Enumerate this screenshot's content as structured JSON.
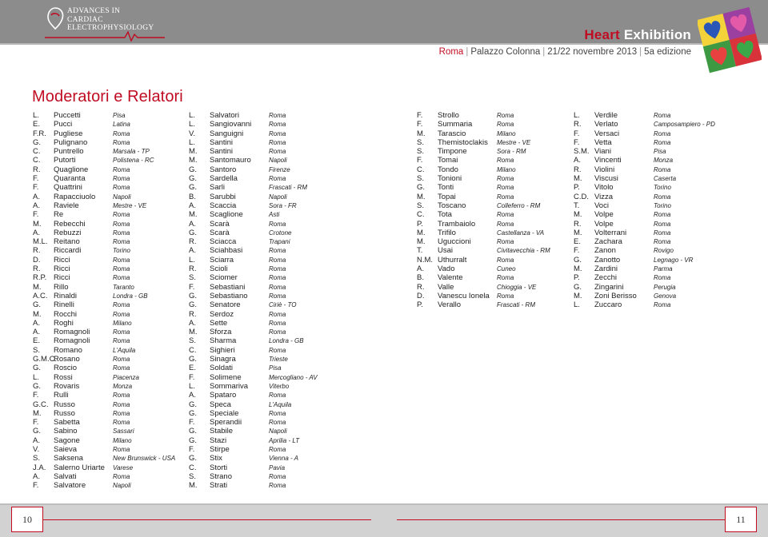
{
  "header": {
    "logo_lines": [
      "Advances in",
      "Cardiac",
      "Electrophysiology"
    ],
    "brand": {
      "prefix": "Heart",
      "suffix": "Exhibition"
    },
    "event": {
      "city": "Roma",
      "venue": "Palazzo Colonna",
      "dates": "21/22 novembre 2013",
      "edition": "5a edizione"
    }
  },
  "page_title": "Moderatori e Relatori",
  "columns": [
    [
      {
        "i": "L.",
        "s": "Puccetti",
        "c": "Pisa"
      },
      {
        "i": "E.",
        "s": "Pucci",
        "c": "Latina"
      },
      {
        "i": "F.R.",
        "s": "Pugliese",
        "c": "Roma"
      },
      {
        "i": "G.",
        "s": "Pulignano",
        "c": "Roma"
      },
      {
        "i": "C.",
        "s": "Puntrello",
        "c": "Marsala - TP"
      },
      {
        "i": "C.",
        "s": "Putorti",
        "c": "Polistena - RC"
      },
      {
        "i": "R.",
        "s": "Quaglione",
        "c": "Roma"
      },
      {
        "i": "F.",
        "s": "Quaranta",
        "c": "Roma"
      },
      {
        "i": "F.",
        "s": "Quattrini",
        "c": "Roma"
      },
      {
        "i": "A.",
        "s": "Rapacciuolo",
        "c": "Napoli"
      },
      {
        "i": "A.",
        "s": "Raviele",
        "c": "Mestre - VE"
      },
      {
        "i": "F.",
        "s": "Re",
        "c": "Roma"
      },
      {
        "i": "M.",
        "s": "Rebecchi",
        "c": "Roma"
      },
      {
        "i": "A.",
        "s": "Rebuzzi",
        "c": "Roma"
      },
      {
        "i": "M.L.",
        "s": "Reitano",
        "c": "Roma"
      },
      {
        "i": "R.",
        "s": "Riccardi",
        "c": "Torino"
      },
      {
        "i": "D.",
        "s": "Ricci",
        "c": "Roma"
      },
      {
        "i": "R.",
        "s": "Ricci",
        "c": "Roma"
      },
      {
        "i": "R.P.",
        "s": "Ricci",
        "c": "Roma"
      },
      {
        "i": "M.",
        "s": "Rillo",
        "c": "Taranto"
      },
      {
        "i": "A.C.",
        "s": "Rinaldi",
        "c": "Londra - GB"
      },
      {
        "i": "G.",
        "s": "Rinelli",
        "c": "Roma"
      },
      {
        "i": "M.",
        "s": "Rocchi",
        "c": "Roma"
      },
      {
        "i": "A.",
        "s": "Roghi",
        "c": "Milano"
      },
      {
        "i": "A.",
        "s": "Romagnoli",
        "c": "Roma"
      },
      {
        "i": "E.",
        "s": "Romagnoli",
        "c": "Roma"
      },
      {
        "i": "S.",
        "s": "Romano",
        "c": "L'Aquila"
      },
      {
        "i": "G.M.C.",
        "s": "Rosano",
        "c": "Roma"
      },
      {
        "i": "G.",
        "s": "Roscio",
        "c": "Roma"
      },
      {
        "i": "L.",
        "s": "Rossi",
        "c": "Piacenza"
      },
      {
        "i": "G.",
        "s": "Rovaris",
        "c": "Monza"
      },
      {
        "i": "F.",
        "s": "Rulli",
        "c": "Roma"
      },
      {
        "i": "G.C.",
        "s": "Russo",
        "c": "Roma"
      },
      {
        "i": "M.",
        "s": "Russo",
        "c": "Roma"
      },
      {
        "i": "F.",
        "s": "Sabetta",
        "c": "Roma"
      },
      {
        "i": "G.",
        "s": "Sabino",
        "c": "Sassari"
      },
      {
        "i": "A.",
        "s": "Sagone",
        "c": "Milano"
      },
      {
        "i": "V.",
        "s": "Saieva",
        "c": "Roma"
      },
      {
        "i": "S.",
        "s": "Saksena",
        "c": "New Brunswick - USA"
      },
      {
        "i": "J.A.",
        "s": "Salerno Uriarte",
        "c": "Varese"
      },
      {
        "i": "A.",
        "s": "Salvati",
        "c": "Roma"
      },
      {
        "i": "F.",
        "s": "Salvatore",
        "c": "Napoli"
      }
    ],
    [
      {
        "i": "L.",
        "s": "Salvatori",
        "c": "Roma"
      },
      {
        "i": "L.",
        "s": "Sangiovanni",
        "c": "Roma"
      },
      {
        "i": "V.",
        "s": "Sanguigni",
        "c": "Roma"
      },
      {
        "i": "L.",
        "s": "Santini",
        "c": "Roma"
      },
      {
        "i": "M.",
        "s": "Santini",
        "c": "Roma"
      },
      {
        "i": "M.",
        "s": "Santomauro",
        "c": "Napoli"
      },
      {
        "i": "G.",
        "s": "Santoro",
        "c": "Firenze"
      },
      {
        "i": "G.",
        "s": "Sardella",
        "c": "Roma"
      },
      {
        "i": "G.",
        "s": "Sarli",
        "c": "Frascati - RM"
      },
      {
        "i": "B.",
        "s": "Sarubbi",
        "c": "Napoli"
      },
      {
        "i": "A.",
        "s": "Scaccia",
        "c": "Sora - FR"
      },
      {
        "i": "M.",
        "s": "Scaglione",
        "c": "Asti"
      },
      {
        "i": "A.",
        "s": "Scarà",
        "c": "Roma"
      },
      {
        "i": "G.",
        "s": "Scarà",
        "c": "Crotone"
      },
      {
        "i": "R.",
        "s": "Sciacca",
        "c": "Trapani"
      },
      {
        "i": "A.",
        "s": "Sciahbasi",
        "c": "Roma"
      },
      {
        "i": "L.",
        "s": "Sciarra",
        "c": "Roma"
      },
      {
        "i": "R.",
        "s": "Scioli",
        "c": "Roma"
      },
      {
        "i": "S.",
        "s": "Sciomer",
        "c": "Roma"
      },
      {
        "i": "F.",
        "s": "Sebastiani",
        "c": "Roma"
      },
      {
        "i": "G.",
        "s": "Sebastiano",
        "c": "Roma"
      },
      {
        "i": "G.",
        "s": "Senatore",
        "c": "Ciriè - TO"
      },
      {
        "i": "R.",
        "s": "Serdoz",
        "c": "Roma"
      },
      {
        "i": "A.",
        "s": "Sette",
        "c": "Roma"
      },
      {
        "i": "M.",
        "s": "Sforza",
        "c": "Roma"
      },
      {
        "i": "S.",
        "s": "Sharma",
        "c": "Londra - GB"
      },
      {
        "i": "C.",
        "s": "Sighieri",
        "c": "Roma"
      },
      {
        "i": "G.",
        "s": "Sinagra",
        "c": "Trieste"
      },
      {
        "i": "E.",
        "s": "Soldati",
        "c": "Pisa"
      },
      {
        "i": "F.",
        "s": "Solimene",
        "c": "Mercogliano - AV"
      },
      {
        "i": "L.",
        "s": "Sommariva",
        "c": "Viterbo"
      },
      {
        "i": "A.",
        "s": "Spataro",
        "c": "Roma"
      },
      {
        "i": "G.",
        "s": "Speca",
        "c": "L'Aquila"
      },
      {
        "i": "G.",
        "s": "Speciale",
        "c": "Roma"
      },
      {
        "i": "F.",
        "s": "Sperandii",
        "c": "Roma"
      },
      {
        "i": "G.",
        "s": "Stabile",
        "c": "Napoli"
      },
      {
        "i": "G.",
        "s": "Stazi",
        "c": "Aprilia - LT"
      },
      {
        "i": "F.",
        "s": "Stirpe",
        "c": "Roma"
      },
      {
        "i": "G.",
        "s": "Stix",
        "c": "Vienna - A"
      },
      {
        "i": "C.",
        "s": "Storti",
        "c": "Pavia"
      },
      {
        "i": "S.",
        "s": "Strano",
        "c": "Roma"
      },
      {
        "i": "M.",
        "s": "Strati",
        "c": "Roma"
      }
    ],
    [
      {
        "i": "F.",
        "s": "Strollo",
        "c": "Roma"
      },
      {
        "i": "F.",
        "s": "Summaria",
        "c": "Roma"
      },
      {
        "i": "M.",
        "s": "Tarascio",
        "c": "Milano"
      },
      {
        "i": "S.",
        "s": "Themistoclakis",
        "c": "Mestre - VE"
      },
      {
        "i": "S.",
        "s": "Timpone",
        "c": "Sora - RM"
      },
      {
        "i": "F.",
        "s": "Tomai",
        "c": "Roma"
      },
      {
        "i": "C.",
        "s": "Tondo",
        "c": "Milano"
      },
      {
        "i": "S.",
        "s": "Tonioni",
        "c": "Roma"
      },
      {
        "i": "G.",
        "s": "Tonti",
        "c": "Roma"
      },
      {
        "i": "M.",
        "s": "Topai",
        "c": "Roma"
      },
      {
        "i": "S.",
        "s": "Toscano",
        "c": "Colleferro - RM"
      },
      {
        "i": "C.",
        "s": "Tota",
        "c": "Roma"
      },
      {
        "i": "P.",
        "s": "Trambaiolo",
        "c": "Roma"
      },
      {
        "i": "M.",
        "s": "Trifilo",
        "c": "Castellanza - VA"
      },
      {
        "i": "M.",
        "s": "Uguccioni",
        "c": "Roma"
      },
      {
        "i": "T.",
        "s": "Usai",
        "c": "Civitavecchia - RM"
      },
      {
        "i": "N.M.",
        "s": "Uthurralt",
        "c": "Roma"
      },
      {
        "i": "A.",
        "s": "Vado",
        "c": "Cuneo"
      },
      {
        "i": "B.",
        "s": "Valente",
        "c": "Roma"
      },
      {
        "i": "R.",
        "s": "Valle",
        "c": "Chioggia - VE"
      },
      {
        "i": "D.",
        "s": "Vanescu Ionela",
        "c": "Roma"
      },
      {
        "i": "P.",
        "s": "Verallo",
        "c": "Frascati - RM"
      }
    ],
    [
      {
        "i": "L.",
        "s": "Verdile",
        "c": "Roma"
      },
      {
        "i": "R.",
        "s": "Verlato",
        "c": "Camposampiero - PD"
      },
      {
        "i": "F.",
        "s": "Versaci",
        "c": "Roma"
      },
      {
        "i": "F.",
        "s": "Vetta",
        "c": "Roma"
      },
      {
        "i": "S.M.",
        "s": "Viani",
        "c": "Pisa"
      },
      {
        "i": "A.",
        "s": "Vincenti",
        "c": "Monza"
      },
      {
        "i": "R.",
        "s": "Violini",
        "c": "Roma"
      },
      {
        "i": "M.",
        "s": "Viscusi",
        "c": "Caserta"
      },
      {
        "i": "P.",
        "s": "Vitolo",
        "c": "Torino"
      },
      {
        "i": "C.D.",
        "s": "Vizza",
        "c": "Roma"
      },
      {
        "i": "T.",
        "s": "Voci",
        "c": "Torino"
      },
      {
        "i": "M.",
        "s": "Volpe",
        "c": "Roma"
      },
      {
        "i": "R.",
        "s": "Volpe",
        "c": "Roma"
      },
      {
        "i": "M.",
        "s": "Volterrani",
        "c": "Roma"
      },
      {
        "i": "E.",
        "s": "Zachara",
        "c": "Roma"
      },
      {
        "i": "F.",
        "s": "Zanon",
        "c": "Rovigo"
      },
      {
        "i": "G.",
        "s": "Zanotto",
        "c": "Legnago - VR"
      },
      {
        "i": "M.",
        "s": "Zardini",
        "c": "Parma"
      },
      {
        "i": "P.",
        "s": "Zecchi",
        "c": "Roma"
      },
      {
        "i": "G.",
        "s": "Zingarini",
        "c": "Perugia"
      },
      {
        "i": "M.",
        "s": "Zoni Berisso",
        "c": "Genova"
      },
      {
        "i": "L.",
        "s": "Zuccaro",
        "c": "Roma"
      }
    ]
  ],
  "footer": {
    "left_page": "10",
    "right_page": "11"
  },
  "colors": {
    "accent": "#c00c22",
    "band": "#8c8c8c",
    "footer_band": "#d2d2d2"
  }
}
